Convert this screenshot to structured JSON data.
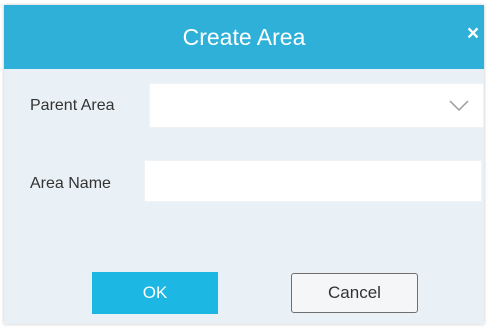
{
  "dialog": {
    "title": "Create Area",
    "close_icon": "close-icon",
    "close_glyph": "×"
  },
  "form": {
    "parent_area": {
      "label": "Parent Area",
      "selected_value": "",
      "icon": "chevron-down-icon"
    },
    "area_name": {
      "label": "Area Name",
      "value": "",
      "placeholder": ""
    }
  },
  "buttons": {
    "ok_label": "OK",
    "cancel_label": "Cancel"
  },
  "colors": {
    "titlebar": "#2eb0d9",
    "ok_button": "#1cb7e2",
    "dialog_background": "#e9f1f6"
  }
}
